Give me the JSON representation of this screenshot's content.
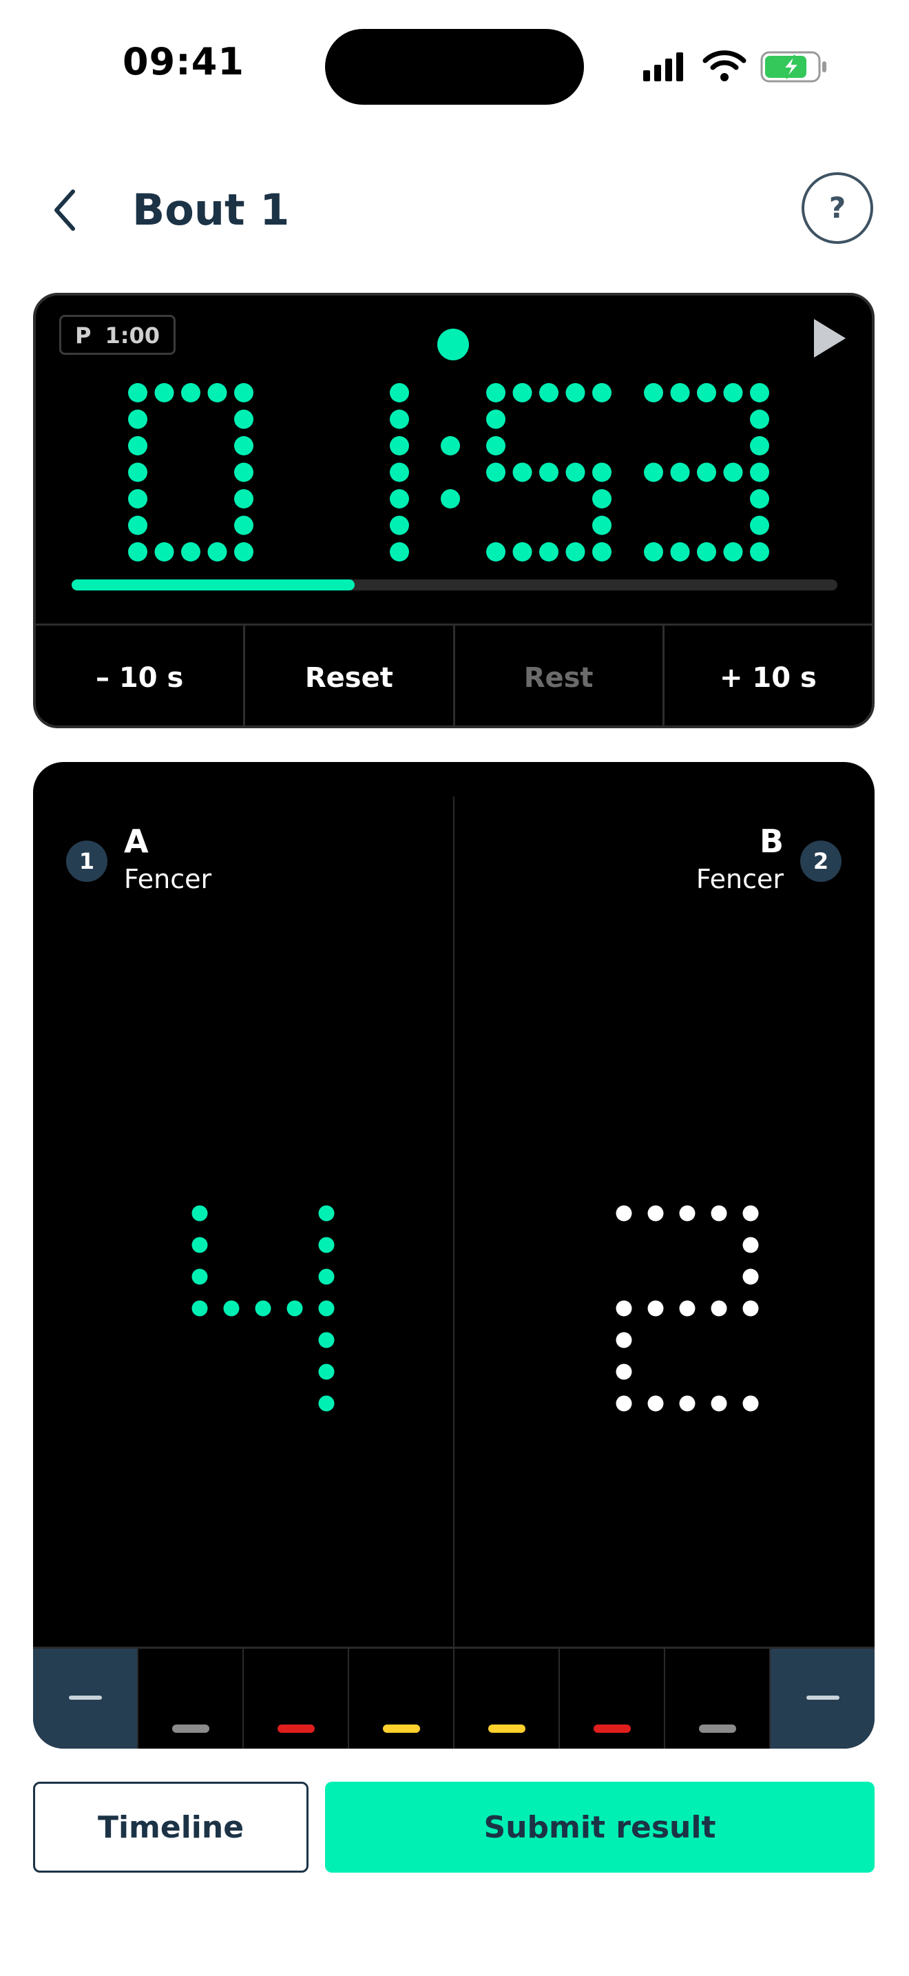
{
  "status_bar": {
    "time": "09:41",
    "icons": [
      "cellular-signal-icon",
      "wifi-icon",
      "battery-charging-icon"
    ]
  },
  "header": {
    "title": "Bout 1",
    "back_icon": "chevron-left-icon",
    "help_label": "?"
  },
  "timer": {
    "period_prefix": "P",
    "period_time": "1:00",
    "display": "01:53",
    "progress": 0.37,
    "digit_color": "#00f0b4",
    "controls": [
      {
        "label": "– 10 s",
        "enabled": true
      },
      {
        "label": "Reset",
        "enabled": true
      },
      {
        "label": "Rest",
        "enabled": false
      },
      {
        "label": "+ 10 s",
        "enabled": true
      }
    ]
  },
  "fencers": {
    "left": {
      "number": "1",
      "letter": "A",
      "role": "Fencer",
      "score": "4",
      "score_color": "#00f0b4"
    },
    "right": {
      "number": "2",
      "letter": "B",
      "role": "Fencer",
      "score": "2",
      "score_color": "#ffffff"
    }
  },
  "penalty_strip": {
    "colors": [
      "#8c8c8c",
      "#e01e1e",
      "#ffd12e",
      "#ffd12e",
      "#e01e1e",
      "#8c8c8c"
    ]
  },
  "actions": {
    "timeline_label": "Timeline",
    "submit_label": "Submit result"
  },
  "colors": {
    "accent": "#00f0b4",
    "navy": "#1c3346",
    "fencer_badge": "#263e52"
  }
}
